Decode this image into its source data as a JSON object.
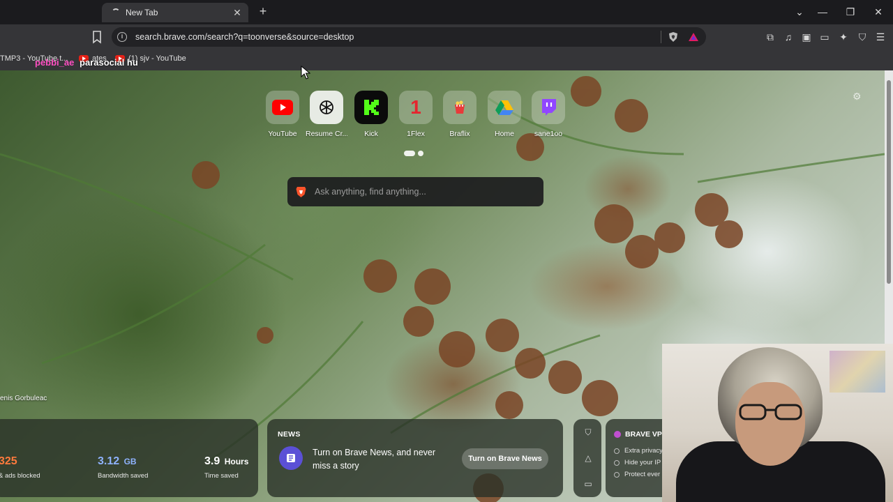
{
  "tab": {
    "title": "New Tab"
  },
  "address_bar": {
    "url": "search.brave.com/search?q=toonverse&source=desktop"
  },
  "bookmarks": [
    {
      "label": "TMP3 - YouTube t..."
    },
    {
      "label": "ates"
    },
    {
      "label": "(1) sjv - YouTube"
    }
  ],
  "overlay": {
    "username": "pebbi_ae",
    "title": "parasocial hu"
  },
  "top_sites": [
    {
      "label": "YouTube",
      "icon": "youtube-icon"
    },
    {
      "label": "Resume Cr...",
      "icon": "openai-icon"
    },
    {
      "label": "Kick",
      "icon": "kick-icon"
    },
    {
      "label": "1Flex",
      "icon": "1flex-icon"
    },
    {
      "label": "Braflix",
      "icon": "braflix-icon"
    },
    {
      "label": "Home",
      "icon": "google-drive-icon"
    },
    {
      "label": "sane1oo",
      "icon": "twitch-icon"
    }
  ],
  "search": {
    "placeholder": "Ask anything, find anything..."
  },
  "photo_credit": "enis Gorbuleac",
  "stats": {
    "blocked_value": "325",
    "blocked_label": "& ads blocked",
    "bandwidth_value": "3.12",
    "bandwidth_unit": "GB",
    "bandwidth_label": "Bandwidth saved",
    "time_value": "3.9",
    "time_unit": "Hours",
    "time_label": "Time saved"
  },
  "news": {
    "header": "NEWS",
    "text": "Turn on Brave News, and never miss a story",
    "button": "Turn on Brave News"
  },
  "vpn": {
    "title": "BRAVE VP",
    "features": [
      "Extra privacy",
      "Hide your IP",
      "Protect ever"
    ]
  },
  "colors": {
    "brave_orange": "#fb542b",
    "news_icon_bg": "#5b50d6",
    "overlay_pink": "#ff4fc2",
    "stats_orange": "#ff7a3d",
    "stats_blue": "#8fb3ff"
  }
}
